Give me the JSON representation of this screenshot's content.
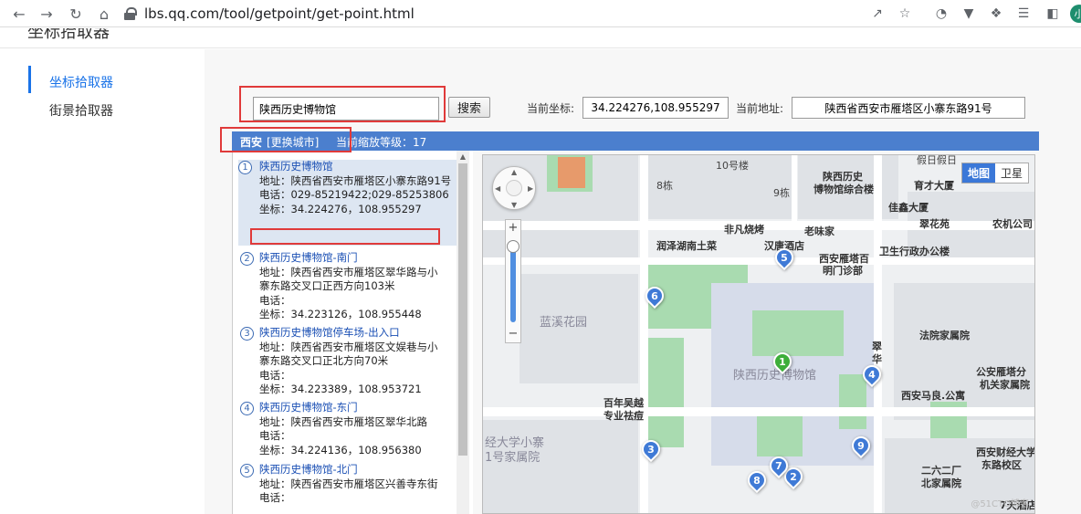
{
  "browser": {
    "url": "lbs.qq.com/tool/getpoint/get-point.html",
    "avatar_letter": "小"
  },
  "page": {
    "title": "坐标拾取器",
    "nav": [
      {
        "label": "坐标拾取器",
        "active": true
      },
      {
        "label": "街景拾取器",
        "active": false
      }
    ]
  },
  "search": {
    "value": "陕西历史博物馆",
    "button": "搜索",
    "coord_label": "当前坐标:",
    "coord_value": "34.224276,108.955297",
    "address_label": "当前地址:",
    "address_value": "陕西省西安市雁塔区小寨东路91号"
  },
  "city_bar": {
    "city": "西安",
    "change": "[更换城市]",
    "zoom_text": "当前缩放等级：17"
  },
  "results": [
    {
      "num": "1",
      "title": "陕西历史博物馆",
      "address": "地址：陕西省西安市雁塔区小寨东路91号",
      "phone": "电话：029-85219422;029-85253806",
      "coord": "坐标：34.224276，108.955297"
    },
    {
      "num": "2",
      "title": "陕西历史博物馆-南门",
      "address": "地址：陕西省西安市雁塔区翠华路与小寨东路交叉口正西方向103米",
      "phone": "电话：",
      "coord": "坐标：34.223126，108.955448"
    },
    {
      "num": "3",
      "title": "陕西历史博物馆停车场-出入口",
      "address": "地址：陕西省西安市雁塔区文娱巷与小寨东路交叉口正北方向70米",
      "phone": "电话：",
      "coord": "坐标：34.223389，108.953721"
    },
    {
      "num": "4",
      "title": "陕西历史博物馆-东门",
      "address": "地址：陕西省西安市雁塔区翠华北路",
      "phone": "电话：",
      "coord": "坐标：34.224136，108.956380"
    },
    {
      "num": "5",
      "title": "陕西历史博物馆-北门",
      "address": "地址：陕西省西安市雁塔区兴善寺东街",
      "phone": "电话：",
      "coord": ""
    }
  ],
  "map": {
    "type_map": "地图",
    "type_sat": "卫星",
    "labels": {
      "l1": "10号楼",
      "l2": "8栋",
      "l3": "9栋",
      "l4": "陕西历史",
      "l4b": "博物馆综合楼",
      "l5": "佳鑫大厦",
      "l6": "育才大厦",
      "l7": "非凡烧烤",
      "l8": "老味家",
      "l9": "翠花苑",
      "l10": "农机公司",
      "l11": "润泽湖南土菜",
      "l12": "汉唐酒店",
      "l13": "卫生行政办公楼",
      "l14": "西安雁塔百",
      "l14b": "明门诊部",
      "l15": "蓝溪花园",
      "l16": "法院家属院",
      "l17": "陕西历史博物馆",
      "l18": "翠",
      "l18b": "华",
      "l19": "公安雁塔分",
      "l19b": "机关家属院",
      "l20": "西安马良.公寓",
      "l21": "百年吴越",
      "l21b": "专业祛痘",
      "l22": "经大学小寨",
      "l22b": "1号家属院",
      "l23": "西安财经大学",
      "l23b": "东路校区",
      "l24": "二六二厂",
      "l24b": "北家属院",
      "l25": "7天酒店",
      "l26": "假日假日"
    },
    "watermark": "@51CTO博客"
  }
}
